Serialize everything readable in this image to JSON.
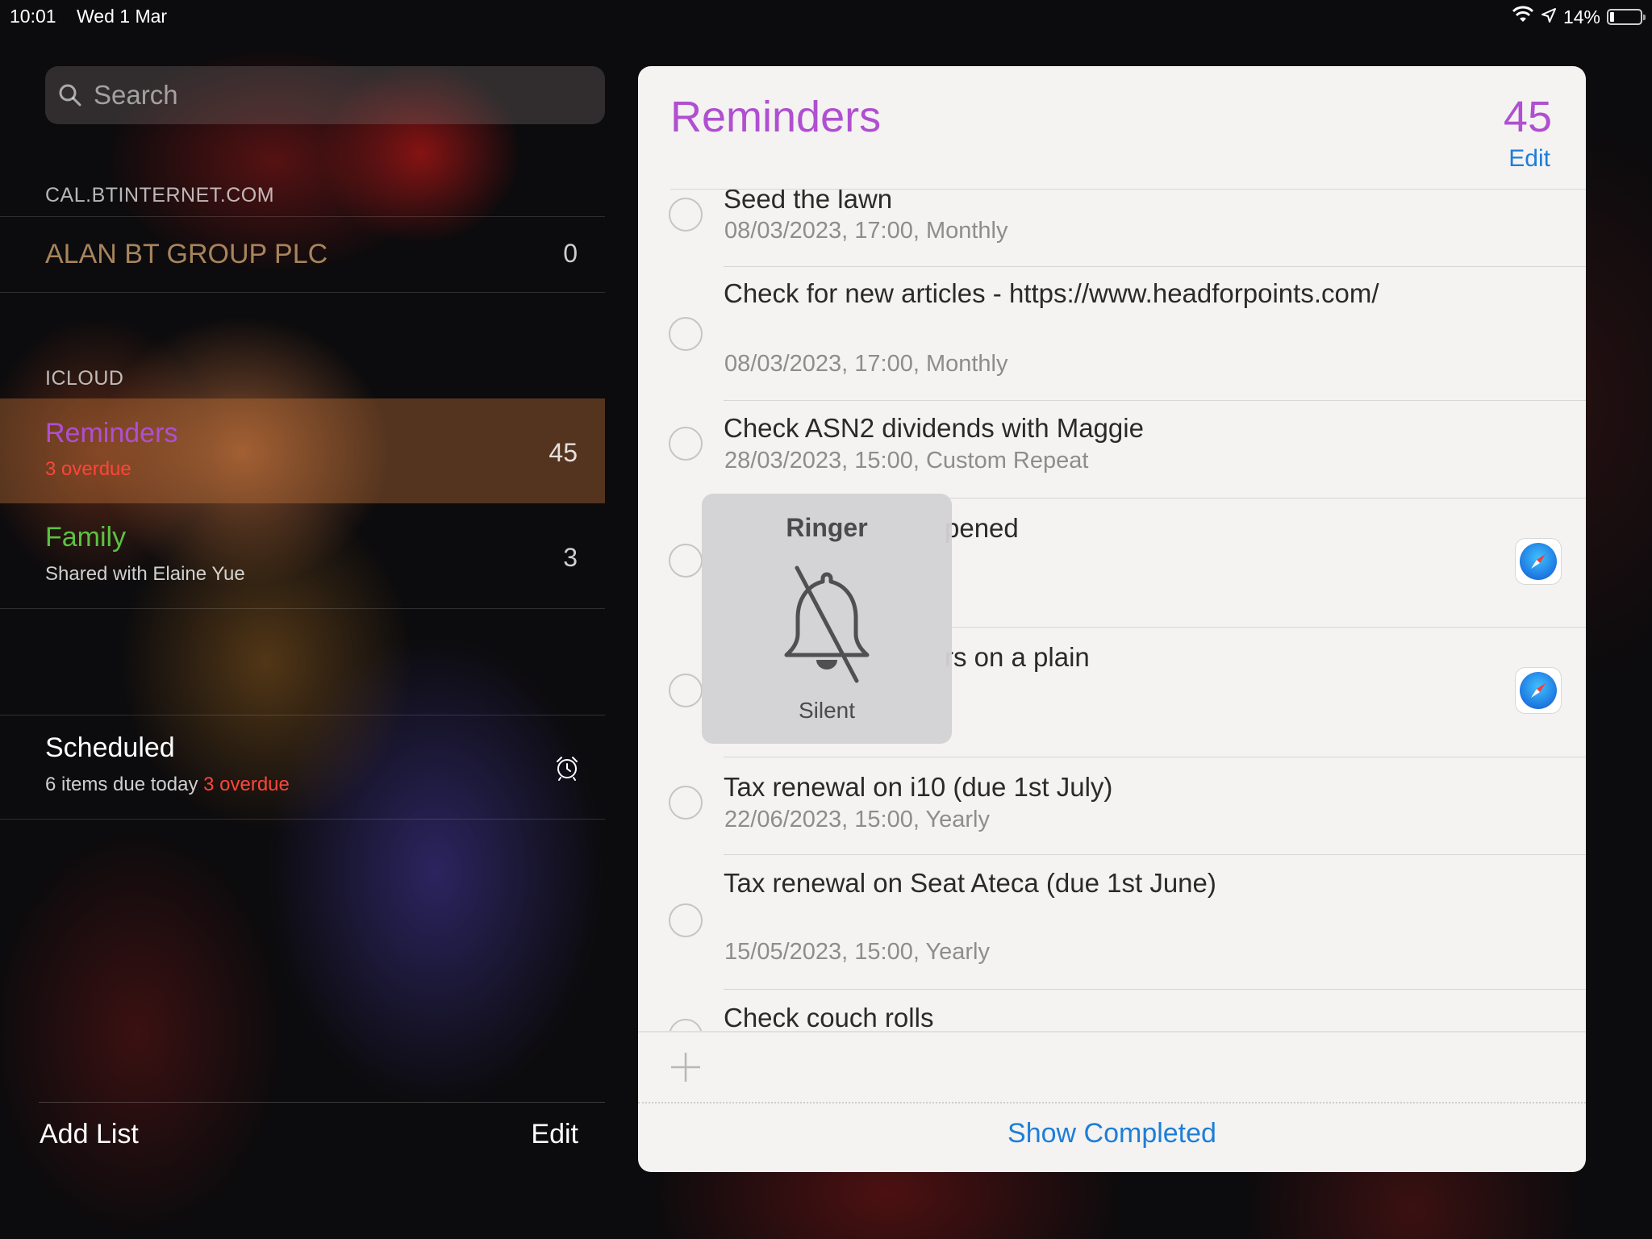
{
  "status_bar": {
    "time": "10:01",
    "date": "Wed 1 Mar",
    "battery": "14%",
    "battery_level": 0.14
  },
  "sidebar": {
    "search_placeholder": "Search",
    "sections": [
      {
        "header": "CAL.BTINTERNET.COM"
      },
      {
        "header": "ICLOUD"
      }
    ],
    "lists": [
      {
        "name": "ALAN BT GROUP PLC",
        "count": "0",
        "color": "#a8845c"
      },
      {
        "name": "Reminders",
        "sub": "3 overdue",
        "count": "45",
        "color": "#b04fd1",
        "sub_color": "#ff453a"
      },
      {
        "name": "Family",
        "sub": "Shared with Elaine Yue",
        "count": "3",
        "color": "#5ac242"
      }
    ],
    "scheduled": {
      "title": "Scheduled",
      "sub_prefix": "6 items due today",
      "sub_overdue": "3 overdue",
      "icon": "alarm-clock-icon"
    },
    "add_list": "Add List",
    "edit": "Edit"
  },
  "panel": {
    "title": "Reminders",
    "count": "45",
    "edit": "Edit",
    "accent": "#b04fd1",
    "link_color": "#1d7ed8",
    "items": [
      {
        "title": "Seed the lawn",
        "detail": "08/03/2023, 17:00, Monthly"
      },
      {
        "title": "Check for new articles - https://www.headforpoints.com/",
        "detail": "08/03/2023, 17:00, Monthly"
      },
      {
        "title": "Check ASN2 dividends with Maggie",
        "detail": "28/03/2023, 15:00, Custom Repeat"
      },
      {
        "title": "pened",
        "detail": "",
        "icon": "safari-icon"
      },
      {
        "title": "rs on a plain",
        "detail": "",
        "icon": "safari-icon"
      },
      {
        "title": "Tax renewal on i10 (due 1st July)",
        "detail": "22/06/2023, 15:00, Yearly"
      },
      {
        "title": "Tax renewal on Seat Ateca (due 1st June)",
        "detail": "15/05/2023, 15:00, Yearly"
      },
      {
        "title": "Check couch rolls",
        "detail": ""
      }
    ],
    "show_completed": "Show Completed"
  },
  "ringer_hud": {
    "title": "Ringer",
    "state": "Silent",
    "icon": "bell-slash-icon"
  }
}
